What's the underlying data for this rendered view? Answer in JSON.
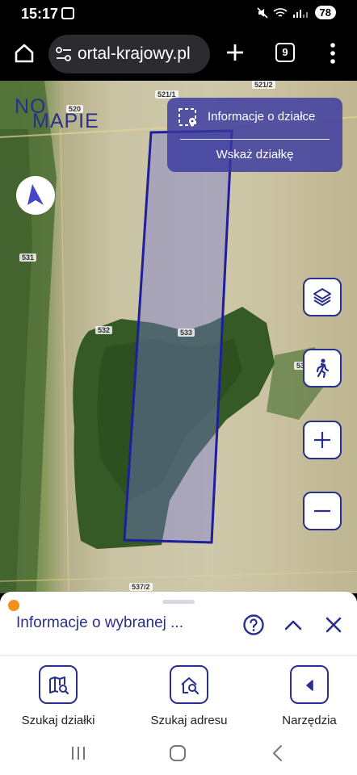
{
  "status_bar": {
    "time": "15:17",
    "battery": "78",
    "icons": [
      "screenshot-icon",
      "mute-icon",
      "wifi-icon",
      "signal-icon"
    ]
  },
  "browser": {
    "url": "ortal-krajowy.pl",
    "tab_count": "9"
  },
  "map": {
    "logo_line1": "NO",
    "logo_line2": "MAPIE",
    "info_panel": {
      "primary_label": "Informacje o działce",
      "secondary_label": "Wskaż działkę"
    },
    "parcel_labels": [
      "520",
      "521/1",
      "521/2",
      "531",
      "532",
      "533",
      "53",
      "537/2"
    ],
    "accent_color": "#2b2f8c",
    "parcel_outline_color": "#1f1f9a"
  },
  "sheet": {
    "title": "Informacje o wybranej ...",
    "indicator_color": "#f3901d"
  },
  "bottom_nav": {
    "items": [
      {
        "label": "Szukaj działki",
        "icon": "map-search-icon"
      },
      {
        "label": "Szukaj adresu",
        "icon": "home-search-icon"
      },
      {
        "label": "Narzędzia",
        "icon": "arrow-left-icon"
      }
    ]
  }
}
